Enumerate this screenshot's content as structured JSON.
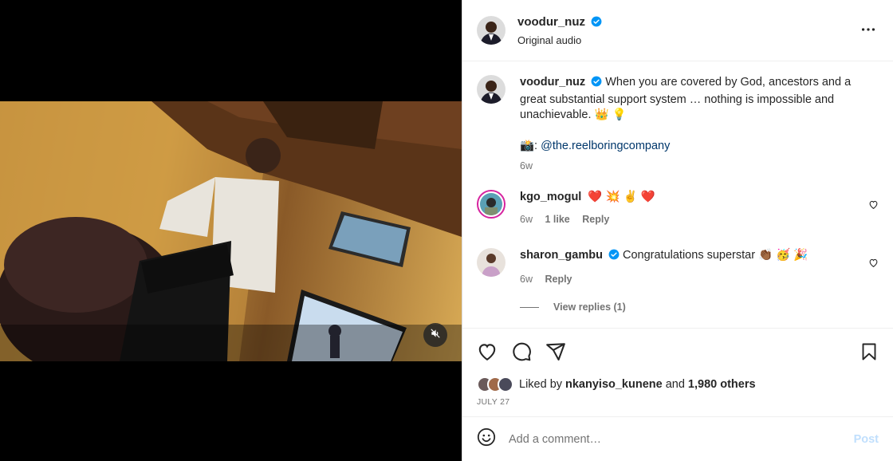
{
  "post": {
    "author": "voodur_nuz",
    "audio": "Original audio"
  },
  "caption": {
    "username": "voodur_nuz",
    "text": "When you are covered by God, ancestors and a great substantial support system … nothing is impossible and unachievable. 👑 💡",
    "credit_prefix": "📸:",
    "credit_mention": "@the.reelboringcompany",
    "time": "6w"
  },
  "comments": [
    {
      "username": "kgo_mogul",
      "text": "❤️ 💥 ✌️ ❤️",
      "time": "6w",
      "likes": "1 like",
      "reply": "Reply"
    },
    {
      "username": "sharon_gambu",
      "text": "Congratulations superstar 👏🏾 🥳 🎉",
      "time": "6w",
      "reply": "Reply",
      "view_replies": "View replies (1)"
    }
  ],
  "likes": {
    "prefix": "Liked by",
    "user": "nkanyiso_kunene",
    "joiner": "and",
    "others": "1,980 others"
  },
  "date": "JULY 27",
  "comment_input": {
    "placeholder": "Add a comment…",
    "post_label": "Post"
  },
  "colors": {
    "verified": "#0095f6",
    "text": "#262626",
    "secondary": "#737373",
    "link": "#00376b",
    "post_disabled": "#c0dffd"
  },
  "icons": [
    "verified-icon",
    "more-options-icon",
    "heart-icon",
    "comment-icon",
    "share-icon",
    "bookmark-icon",
    "emoji-icon",
    "muted-icon"
  ]
}
